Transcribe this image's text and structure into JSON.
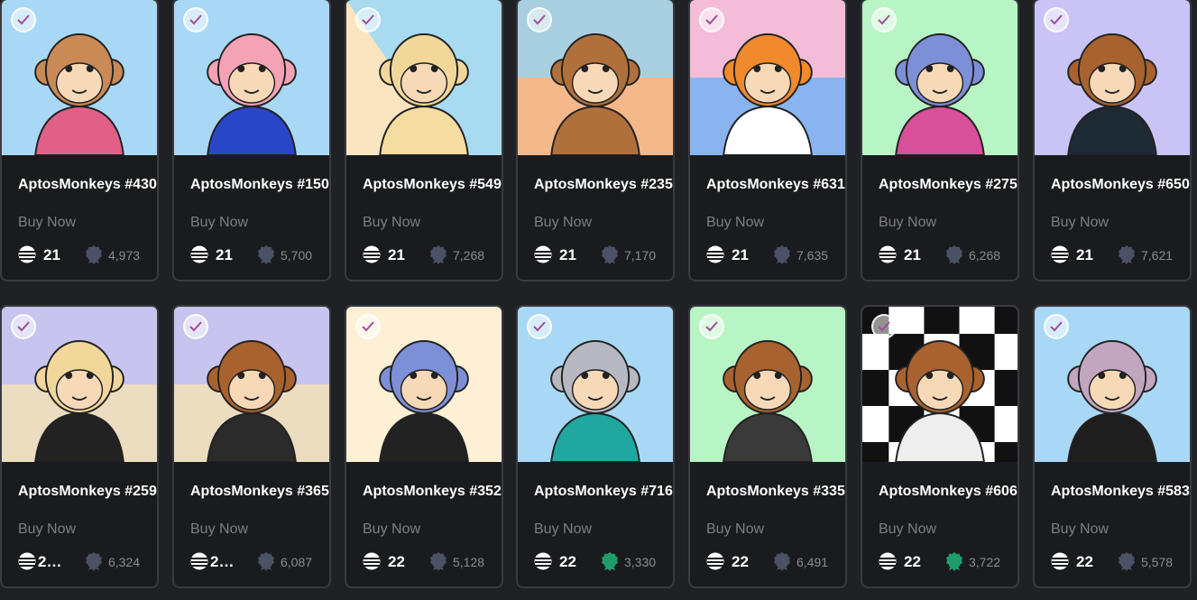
{
  "colors": {
    "background": "#202124",
    "card": "#1a1b1e",
    "card_border": "#3a3b3f",
    "rank_default": "#4b5266",
    "rank_top": "#1f9e6a"
  },
  "icons": {
    "check": "check-circle-icon",
    "price": "aptos-coin-icon",
    "rank": "rank-rosette-icon"
  },
  "cards": [
    {
      "title": "AptosMonkeys #430",
      "buy": "Buy Now",
      "price": "21",
      "rank": "4,973",
      "rank_level": "default",
      "bg": "#a8d8f5"
    },
    {
      "title": "AptosMonkeys #150",
      "buy": "Buy Now",
      "price": "21",
      "rank": "5,700",
      "rank_level": "default",
      "bg": "#a8d8f5"
    },
    {
      "title": "AptosMonkeys #549",
      "buy": "Buy Now",
      "price": "21",
      "rank": "7,268",
      "rank_level": "default",
      "bg": "#fbe5c0"
    },
    {
      "title": "AptosMonkeys #235",
      "buy": "Buy Now",
      "price": "21",
      "rank": "7,170",
      "rank_level": "default",
      "bg": "#f5c89a"
    },
    {
      "title": "AptosMonkeys #631",
      "buy": "Buy Now",
      "price": "21",
      "rank": "7,635",
      "rank_level": "default",
      "bg": "#c6c8f5"
    },
    {
      "title": "AptosMonkeys #275",
      "buy": "Buy Now",
      "price": "21",
      "rank": "6,268",
      "rank_level": "default",
      "bg": "#b8f5c4"
    },
    {
      "title": "AptosMonkeys #650",
      "buy": "Buy Now",
      "price": "21",
      "rank": "7,621",
      "rank_level": "default",
      "bg": "#c9c4f5"
    },
    {
      "title": "AptosMonkeys #259",
      "buy": "Buy Now",
      "price": "2…",
      "rank": "6,324",
      "rank_level": "default",
      "bg": "#d8c8e8"
    },
    {
      "title": "AptosMonkeys #365",
      "buy": "Buy Now",
      "price": "2…",
      "rank": "6,087",
      "rank_level": "default",
      "bg": "#d8cde8"
    },
    {
      "title": "AptosMonkeys #352",
      "buy": "Buy Now",
      "price": "22",
      "rank": "5,128",
      "rank_level": "default",
      "bg": "#fdf0d5"
    },
    {
      "title": "AptosMonkeys #716",
      "buy": "Buy Now",
      "price": "22",
      "rank": "3,330",
      "rank_level": "top",
      "bg": "#a8d8f5"
    },
    {
      "title": "AptosMonkeys #335",
      "buy": "Buy Now",
      "price": "22",
      "rank": "6,491",
      "rank_level": "default",
      "bg": "#b8f5c4"
    },
    {
      "title": "AptosMonkeys #606",
      "buy": "Buy Now",
      "price": "22",
      "rank": "3,722",
      "rank_level": "top",
      "bg": "#ffffff"
    },
    {
      "title": "AptosMonkeys #583",
      "buy": "Buy Now",
      "price": "22",
      "rank": "5,578",
      "rank_level": "default",
      "bg": "#a8d8f5"
    }
  ]
}
